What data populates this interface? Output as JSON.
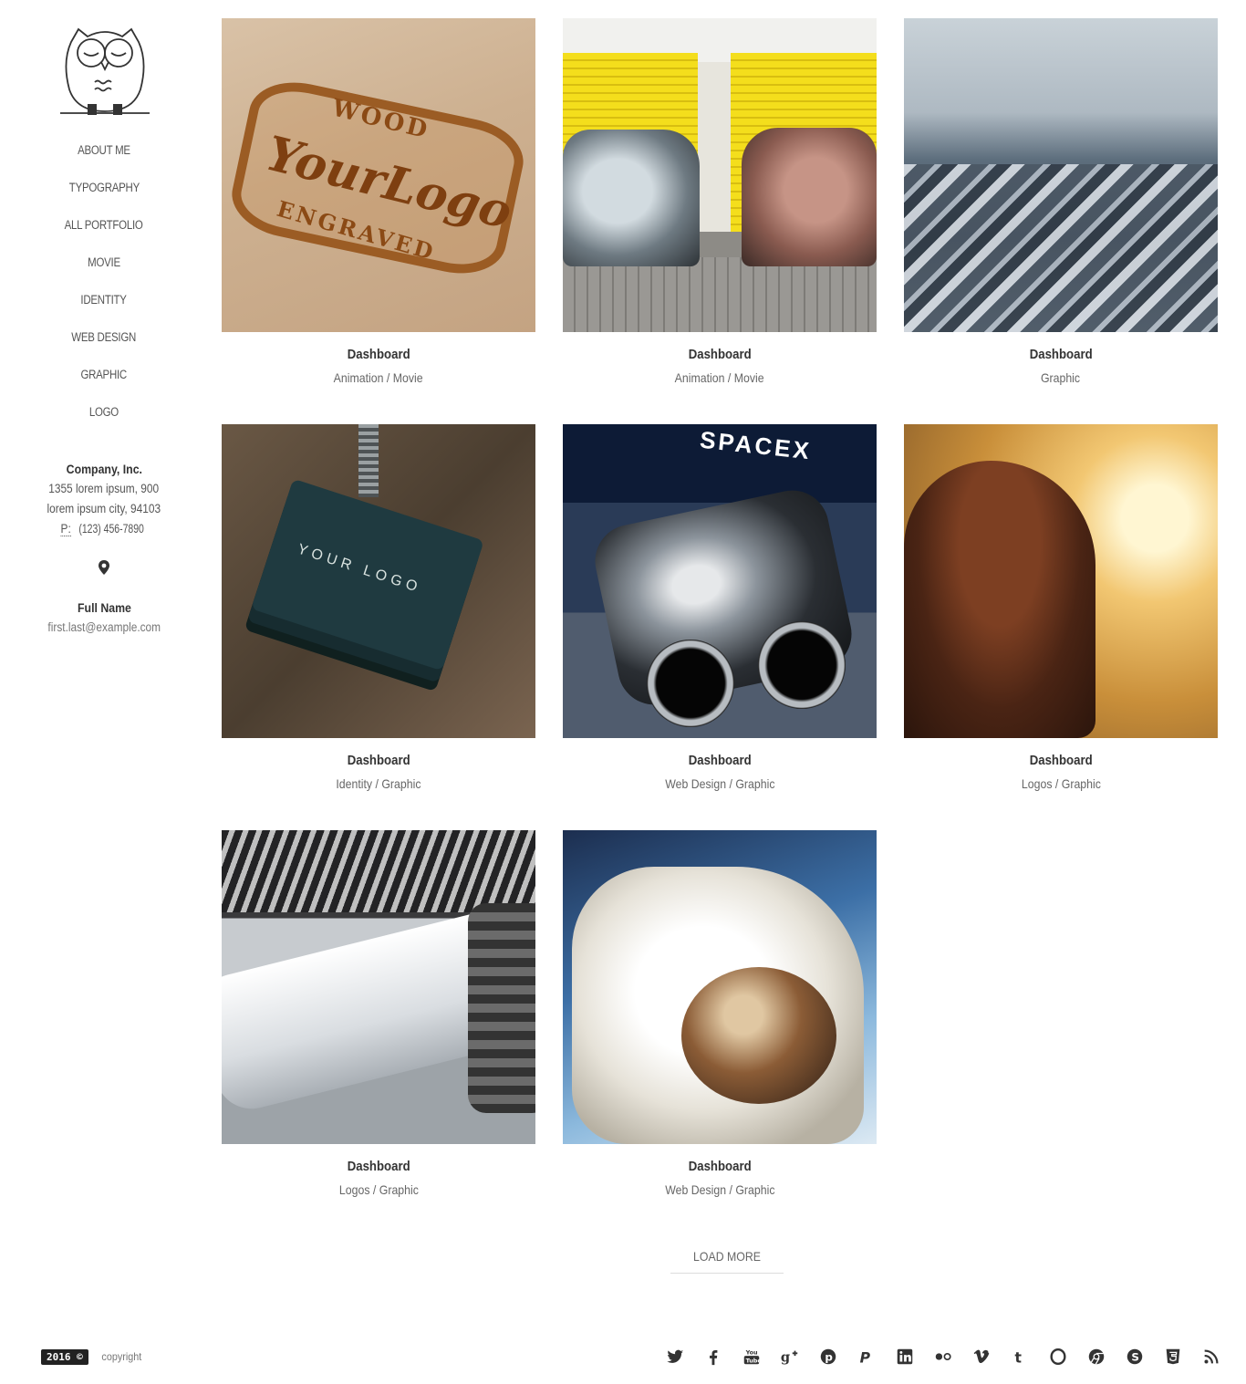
{
  "sidebar": {
    "nav": [
      {
        "label": "ABOUT ME"
      },
      {
        "label": "TYPOGRAPHY"
      },
      {
        "label": "ALL PORTFOLIO"
      },
      {
        "label": "MOVIE"
      },
      {
        "label": "IDENTITY"
      },
      {
        "label": "WEB DESIGN"
      },
      {
        "label": "GRAPHIC"
      },
      {
        "label": "LOGO"
      }
    ],
    "company": {
      "name": "Company, Inc.",
      "address1": "1355 lorem ipsum, 900",
      "address2": "lorem ipsum city, 94103",
      "phone_label": "P:",
      "phone": "(123) 456-7890"
    },
    "contact": {
      "name": "Full Name",
      "email": "first.last@example.com"
    }
  },
  "portfolio": [
    {
      "title": "Dashboard",
      "category": "Animation / Movie",
      "image": "wood-logo"
    },
    {
      "title": "Dashboard",
      "category": "Animation / Movie",
      "image": "vintage-cars"
    },
    {
      "title": "Dashboard",
      "category": "Graphic",
      "image": "city-rooftops"
    },
    {
      "title": "Dashboard",
      "category": "Identity / Graphic",
      "image": "business-cards"
    },
    {
      "title": "Dashboard",
      "category": "Web Design / Graphic",
      "image": "rocket-engine"
    },
    {
      "title": "Dashboard",
      "category": "Logos / Graphic",
      "image": "girl-sunset"
    },
    {
      "title": "Dashboard",
      "category": "Logos / Graphic",
      "image": "rocket-hangar"
    },
    {
      "title": "Dashboard",
      "category": "Web Design / Graphic",
      "image": "astronaut"
    }
  ],
  "images": {
    "wood_t1": "WOOD",
    "wood_t2": "YourLogo",
    "wood_t3": "ENGRAVED",
    "cards_text": "YOUR LOGO",
    "spacex_text": "SPACEX"
  },
  "load_more": "LOAD MORE",
  "footer": {
    "year": "2016 ©",
    "copyright": "copyright",
    "social": [
      "twitter-icon",
      "facebook-icon",
      "youtube-icon",
      "google-plus-icon",
      "pinterest-icon",
      "paypal-icon",
      "linkedin-icon",
      "flickr-icon",
      "vimeo-icon",
      "tumblr-icon",
      "opera-icon",
      "chrome-icon",
      "skype-icon",
      "html5-icon",
      "rss-icon"
    ]
  }
}
